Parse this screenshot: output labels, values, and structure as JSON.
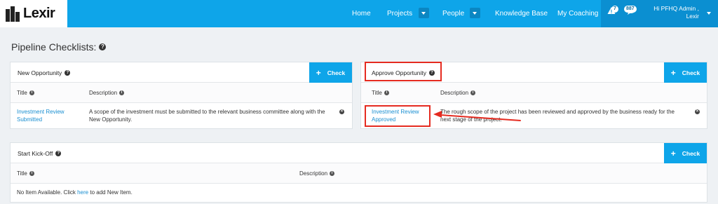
{
  "brand": {
    "name": "Lexir"
  },
  "nav": {
    "items": [
      {
        "label": "Home"
      },
      {
        "label": "Projects"
      },
      {
        "label": "People"
      },
      {
        "label": "Knowledge Base"
      },
      {
        "label": "My Coaching"
      }
    ],
    "alerts_count": "7",
    "messages_count": "887",
    "user_line1": "Hi PFHQ Admin ,",
    "user_line2": "Lexir"
  },
  "page": {
    "title": "Pipeline Checklists:"
  },
  "cards": [
    {
      "title": "New Opportunity",
      "button": "Check",
      "col_title": "Title",
      "col_description": "Description",
      "rows": [
        {
          "title": "Investment Review Submitted",
          "description": "A scope of the investment must be submitted to the relevant business committee along with the New Opportunity."
        }
      ]
    },
    {
      "title": "Approve Opportunity",
      "button": "Check",
      "col_title": "Title",
      "col_description": "Description",
      "rows": [
        {
          "title": "Investment Review Approved",
          "description": "The rough scope of the project has been reviewed and approved by the business ready for the next stage of the project."
        }
      ]
    },
    {
      "title": "Start Kick-Off",
      "button": "Check",
      "col_title": "Title",
      "col_description": "Description",
      "empty_prefix": "No Item Available. Click ",
      "empty_link": "here",
      "empty_suffix": " to add New Item."
    }
  ],
  "icons": {
    "help": "question-circle-icon",
    "info": "info-circle-icon",
    "remove": "close-circle-icon",
    "alert": "warning-triangle-icon",
    "messages": "chat-bubble-icon"
  },
  "colors": {
    "accent": "#0ea5e9",
    "annotation": "#e52b20",
    "link": "#1a8fd1"
  }
}
